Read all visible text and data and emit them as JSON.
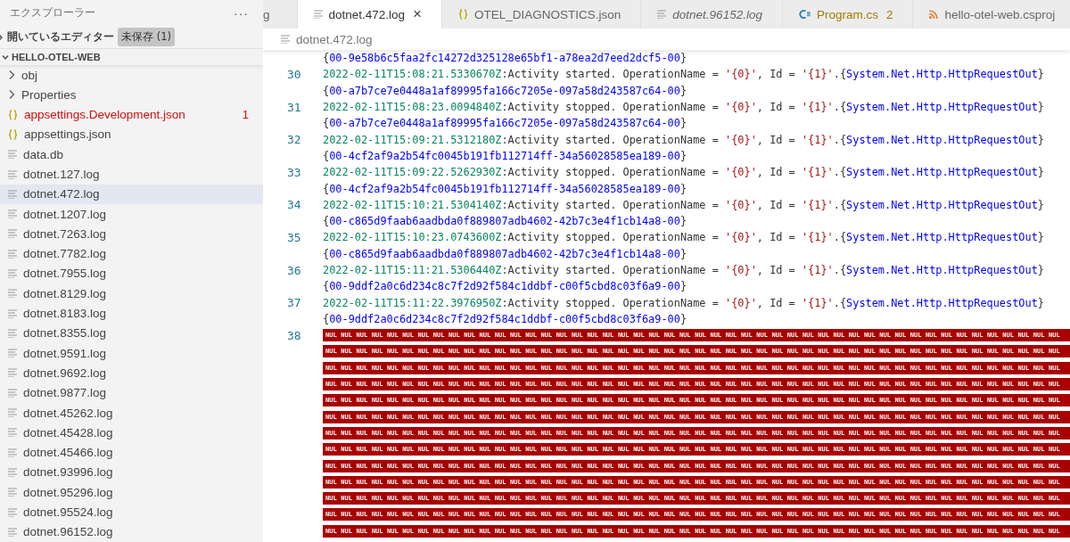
{
  "sidebar": {
    "title": "エクスプローラー",
    "more": "···",
    "open_editors": {
      "label": "開いているエディター",
      "badge": "未保存 (1)",
      "expanded": false
    },
    "project": {
      "label": "HELLO-OTEL-WEB",
      "expanded": true,
      "items": [
        {
          "label": "obj",
          "kind": "folder",
          "selected": false,
          "error": false
        },
        {
          "label": "Properties",
          "kind": "folder",
          "selected": false,
          "error": false
        },
        {
          "label": "appsettings.Development.json",
          "kind": "json",
          "selected": false,
          "error": true,
          "count": "1"
        },
        {
          "label": "appsettings.json",
          "kind": "json",
          "selected": false,
          "error": false
        },
        {
          "label": "data.db",
          "kind": "file",
          "selected": false,
          "error": false
        },
        {
          "label": "dotnet.127.log",
          "kind": "file",
          "selected": false,
          "error": false
        },
        {
          "label": "dotnet.472.log",
          "kind": "file",
          "selected": true,
          "error": false
        },
        {
          "label": "dotnet.1207.log",
          "kind": "file",
          "selected": false,
          "error": false
        },
        {
          "label": "dotnet.7263.log",
          "kind": "file",
          "selected": false,
          "error": false
        },
        {
          "label": "dotnet.7782.log",
          "kind": "file",
          "selected": false,
          "error": false
        },
        {
          "label": "dotnet.7955.log",
          "kind": "file",
          "selected": false,
          "error": false
        },
        {
          "label": "dotnet.8129.log",
          "kind": "file",
          "selected": false,
          "error": false
        },
        {
          "label": "dotnet.8183.log",
          "kind": "file",
          "selected": false,
          "error": false
        },
        {
          "label": "dotnet.8355.log",
          "kind": "file",
          "selected": false,
          "error": false
        },
        {
          "label": "dotnet.9591.log",
          "kind": "file",
          "selected": false,
          "error": false
        },
        {
          "label": "dotnet.9692.log",
          "kind": "file",
          "selected": false,
          "error": false
        },
        {
          "label": "dotnet.9877.log",
          "kind": "file",
          "selected": false,
          "error": false
        },
        {
          "label": "dotnet.45262.log",
          "kind": "file",
          "selected": false,
          "error": false
        },
        {
          "label": "dotnet.45428.log",
          "kind": "file",
          "selected": false,
          "error": false
        },
        {
          "label": "dotnet.45466.log",
          "kind": "file",
          "selected": false,
          "error": false
        },
        {
          "label": "dotnet.93996.log",
          "kind": "file",
          "selected": false,
          "error": false
        },
        {
          "label": "dotnet.95296.log",
          "kind": "file",
          "selected": false,
          "error": false
        },
        {
          "label": "dotnet.95524.log",
          "kind": "file",
          "selected": false,
          "error": false
        },
        {
          "label": "dotnet.96152.log",
          "kind": "file",
          "selected": false,
          "error": false
        }
      ]
    }
  },
  "tabs": [
    {
      "label": "g",
      "kind": "none",
      "selected": false,
      "italic": false,
      "warning": false
    },
    {
      "label": "dotnet.472.log",
      "kind": "file",
      "selected": true,
      "italic": false,
      "warning": false,
      "close": "×"
    },
    {
      "label": "OTEL_DIAGNOSTICS.json",
      "kind": "json",
      "selected": false,
      "italic": false,
      "warning": false
    },
    {
      "label": "dotnet.96152.log",
      "kind": "file",
      "selected": false,
      "italic": true,
      "warning": false
    },
    {
      "label": "Program.cs",
      "kind": "csharp",
      "selected": false,
      "italic": false,
      "warning": true,
      "count": "2"
    },
    {
      "label": "hello-otel-web.csproj",
      "kind": "rss",
      "selected": false,
      "italic": false,
      "warning": false
    }
  ],
  "breadcrumb": {
    "label": "dotnet.472.log"
  },
  "editor": {
    "rows": [
      {
        "segments": [
          {
            "kind": "plain",
            "text": "{"
          },
          {
            "kind": "type",
            "text": "00-9e58b6c5faa2fc14272d325128e65bf1-a78ea2d7eed2dcf5-00"
          },
          {
            "kind": "plain",
            "text": "}"
          }
        ]
      },
      {
        "number": "30",
        "segments": [
          {
            "kind": "timestamp",
            "text": "2022-02-11T15:08:21.5330670Z"
          },
          {
            "kind": "plain",
            "text": ":Activity started. OperationName = "
          },
          {
            "kind": "string",
            "text": "'{0}'"
          },
          {
            "kind": "plain",
            "text": ", Id = "
          },
          {
            "kind": "string",
            "text": "'{1}'"
          },
          {
            "kind": "plain",
            "text": ".{"
          },
          {
            "kind": "type",
            "text": "System.Net.Http.HttpRequestOut"
          },
          {
            "kind": "plain",
            "text": "}"
          }
        ]
      },
      {
        "segments": [
          {
            "kind": "plain",
            "text": "{"
          },
          {
            "kind": "type",
            "text": "00-a7b7ce7e0448a1af89995fa166c7205e-097a58d243587c64-00"
          },
          {
            "kind": "plain",
            "text": "}"
          }
        ]
      },
      {
        "number": "31",
        "segments": [
          {
            "kind": "timestamp",
            "text": "2022-02-11T15:08:23.0094840Z"
          },
          {
            "kind": "plain",
            "text": ":Activity stopped. OperationName = "
          },
          {
            "kind": "string",
            "text": "'{0}'"
          },
          {
            "kind": "plain",
            "text": ", Id = "
          },
          {
            "kind": "string",
            "text": "'{1}'"
          },
          {
            "kind": "plain",
            "text": ".{"
          },
          {
            "kind": "type",
            "text": "System.Net.Http.HttpRequestOut"
          },
          {
            "kind": "plain",
            "text": "}"
          }
        ]
      },
      {
        "segments": [
          {
            "kind": "plain",
            "text": "{"
          },
          {
            "kind": "type",
            "text": "00-a7b7ce7e0448a1af89995fa166c7205e-097a58d243587c64-00"
          },
          {
            "kind": "plain",
            "text": "}"
          }
        ]
      },
      {
        "number": "32",
        "segments": [
          {
            "kind": "timestamp",
            "text": "2022-02-11T15:09:21.5312180Z"
          },
          {
            "kind": "plain",
            "text": ":Activity started. OperationName = "
          },
          {
            "kind": "string",
            "text": "'{0}'"
          },
          {
            "kind": "plain",
            "text": ", Id = "
          },
          {
            "kind": "string",
            "text": "'{1}'"
          },
          {
            "kind": "plain",
            "text": ".{"
          },
          {
            "kind": "type",
            "text": "System.Net.Http.HttpRequestOut"
          },
          {
            "kind": "plain",
            "text": "}"
          }
        ]
      },
      {
        "segments": [
          {
            "kind": "plain",
            "text": "{"
          },
          {
            "kind": "type",
            "text": "00-4cf2af9a2b54fc0045b191fb112714ff-34a56028585ea189-00"
          },
          {
            "kind": "plain",
            "text": "}"
          }
        ]
      },
      {
        "number": "33",
        "segments": [
          {
            "kind": "timestamp",
            "text": "2022-02-11T15:09:22.5262930Z"
          },
          {
            "kind": "plain",
            "text": ":Activity stopped. OperationName = "
          },
          {
            "kind": "string",
            "text": "'{0}'"
          },
          {
            "kind": "plain",
            "text": ", Id = "
          },
          {
            "kind": "string",
            "text": "'{1}'"
          },
          {
            "kind": "plain",
            "text": ".{"
          },
          {
            "kind": "type",
            "text": "System.Net.Http.HttpRequestOut"
          },
          {
            "kind": "plain",
            "text": "}"
          }
        ]
      },
      {
        "segments": [
          {
            "kind": "plain",
            "text": "{"
          },
          {
            "kind": "type",
            "text": "00-4cf2af9a2b54fc0045b191fb112714ff-34a56028585ea189-00"
          },
          {
            "kind": "plain",
            "text": "}"
          }
        ]
      },
      {
        "number": "34",
        "segments": [
          {
            "kind": "timestamp",
            "text": "2022-02-11T15:10:21.5304140Z"
          },
          {
            "kind": "plain",
            "text": ":Activity started. OperationName = "
          },
          {
            "kind": "string",
            "text": "'{0}'"
          },
          {
            "kind": "plain",
            "text": ", Id = "
          },
          {
            "kind": "string",
            "text": "'{1}'"
          },
          {
            "kind": "plain",
            "text": ".{"
          },
          {
            "kind": "type",
            "text": "System.Net.Http.HttpRequestOut"
          },
          {
            "kind": "plain",
            "text": "}"
          }
        ]
      },
      {
        "segments": [
          {
            "kind": "plain",
            "text": "{"
          },
          {
            "kind": "type",
            "text": "00-c865d9faab6aadbda0f889807adb4602-42b7c3e4f1cb14a8-00"
          },
          {
            "kind": "plain",
            "text": "}"
          }
        ]
      },
      {
        "number": "35",
        "segments": [
          {
            "kind": "timestamp",
            "text": "2022-02-11T15:10:23.0743600Z"
          },
          {
            "kind": "plain",
            "text": ":Activity stopped. OperationName = "
          },
          {
            "kind": "string",
            "text": "'{0}'"
          },
          {
            "kind": "plain",
            "text": ", Id = "
          },
          {
            "kind": "string",
            "text": "'{1}'"
          },
          {
            "kind": "plain",
            "text": ".{"
          },
          {
            "kind": "type",
            "text": "System.Net.Http.HttpRequestOut"
          },
          {
            "kind": "plain",
            "text": "}"
          }
        ]
      },
      {
        "segments": [
          {
            "kind": "plain",
            "text": "{"
          },
          {
            "kind": "type",
            "text": "00-c865d9faab6aadbda0f889807adb4602-42b7c3e4f1cb14a8-00"
          },
          {
            "kind": "plain",
            "text": "}"
          }
        ]
      },
      {
        "number": "36",
        "segments": [
          {
            "kind": "timestamp",
            "text": "2022-02-11T15:11:21.5306440Z"
          },
          {
            "kind": "plain",
            "text": ":Activity started. OperationName = "
          },
          {
            "kind": "string",
            "text": "'{0}'"
          },
          {
            "kind": "plain",
            "text": ", Id = "
          },
          {
            "kind": "string",
            "text": "'{1}'"
          },
          {
            "kind": "plain",
            "text": ".{"
          },
          {
            "kind": "type",
            "text": "System.Net.Http.HttpRequestOut"
          },
          {
            "kind": "plain",
            "text": "}"
          }
        ]
      },
      {
        "segments": [
          {
            "kind": "plain",
            "text": "{"
          },
          {
            "kind": "type",
            "text": "00-9ddf2a0c6d234c8c7f2d92f584c1ddbf-c00f5cbd8c03f6a9-00"
          },
          {
            "kind": "plain",
            "text": "}"
          }
        ]
      },
      {
        "number": "37",
        "segments": [
          {
            "kind": "timestamp",
            "text": "2022-02-11T15:11:22.3976950Z"
          },
          {
            "kind": "plain",
            "text": ":Activity stopped. OperationName = "
          },
          {
            "kind": "string",
            "text": "'{0}'"
          },
          {
            "kind": "plain",
            "text": ", Id = "
          },
          {
            "kind": "string",
            "text": "'{1}'"
          },
          {
            "kind": "plain",
            "text": ".{"
          },
          {
            "kind": "type",
            "text": "System.Net.Http.HttpRequestOut"
          },
          {
            "kind": "plain",
            "text": "}"
          }
        ]
      },
      {
        "segments": [
          {
            "kind": "plain",
            "text": "{"
          },
          {
            "kind": "type",
            "text": "00-9ddf2a0c6d234c8c7f2d92f584c1ddbf-c00f5cbd8c03f6a9-00"
          },
          {
            "kind": "plain",
            "text": "}"
          }
        ]
      },
      {
        "number": "38",
        "segments": [
          {
            "kind": "nul",
            "text": "NUL NUL NUL NUL NUL NUL NUL NUL NUL NUL NUL NUL NUL NUL NUL NUL NUL NUL NUL NUL NUL NUL NUL NUL NUL NUL NUL NUL NUL NUL NUL NUL NUL NUL NUL NUL NUL NUL NUL NUL NUL NUL NUL NUL NUL NUL NUL NUL"
          }
        ]
      },
      {
        "segments": [
          {
            "kind": "nul",
            "text": "NUL NUL NUL NUL NUL NUL NUL NUL NUL NUL NUL NUL NUL NUL NUL NUL NUL NUL NUL NUL NUL NUL NUL NUL NUL NUL NUL NUL NUL NUL NUL NUL NUL NUL NUL NUL NUL NUL NUL NUL NUL NUL NUL NUL NUL NUL NUL NUL"
          }
        ]
      },
      {
        "segments": [
          {
            "kind": "nul",
            "text": "NUL NUL NUL NUL NUL NUL NUL NUL NUL NUL NUL NUL NUL NUL NUL NUL NUL NUL NUL NUL NUL NUL NUL NUL NUL NUL NUL NUL NUL NUL NUL NUL NUL NUL NUL NUL NUL NUL NUL NUL NUL NUL NUL NUL NUL NUL NUL NUL"
          }
        ]
      },
      {
        "segments": [
          {
            "kind": "nul",
            "text": "NUL NUL NUL NUL NUL NUL NUL NUL NUL NUL NUL NUL NUL NUL NUL NUL NUL NUL NUL NUL NUL NUL NUL NUL NUL NUL NUL NUL NUL NUL NUL NUL NUL NUL NUL NUL NUL NUL NUL NUL NUL NUL NUL NUL NUL NUL NUL NUL"
          }
        ]
      },
      {
        "segments": [
          {
            "kind": "nul",
            "text": "NUL NUL NUL NUL NUL NUL NUL NUL NUL NUL NUL NUL NUL NUL NUL NUL NUL NUL NUL NUL NUL NUL NUL NUL NUL NUL NUL NUL NUL NUL NUL NUL NUL NUL NUL NUL NUL NUL NUL NUL NUL NUL NUL NUL NUL NUL NUL NUL"
          }
        ]
      },
      {
        "segments": [
          {
            "kind": "nul",
            "text": "NUL NUL NUL NUL NUL NUL NUL NUL NUL NUL NUL NUL NUL NUL NUL NUL NUL NUL NUL NUL NUL NUL NUL NUL NUL NUL NUL NUL NUL NUL NUL NUL NUL NUL NUL NUL NUL NUL NUL NUL NUL NUL NUL NUL NUL NUL NUL NUL"
          }
        ]
      },
      {
        "segments": [
          {
            "kind": "nul",
            "text": "NUL NUL NUL NUL NUL NUL NUL NUL NUL NUL NUL NUL NUL NUL NUL NUL NUL NUL NUL NUL NUL NUL NUL NUL NUL NUL NUL NUL NUL NUL NUL NUL NUL NUL NUL NUL NUL NUL NUL NUL NUL NUL NUL NUL NUL NUL NUL NUL"
          }
        ]
      },
      {
        "segments": [
          {
            "kind": "nul",
            "text": "NUL NUL NUL NUL NUL NUL NUL NUL NUL NUL NUL NUL NUL NUL NUL NUL NUL NUL NUL NUL NUL NUL NUL NUL NUL NUL NUL NUL NUL NUL NUL NUL NUL NUL NUL NUL NUL NUL NUL NUL NUL NUL NUL NUL NUL NUL NUL NUL"
          }
        ]
      },
      {
        "segments": [
          {
            "kind": "nul",
            "text": "NUL NUL NUL NUL NUL NUL NUL NUL NUL NUL NUL NUL NUL NUL NUL NUL NUL NUL NUL NUL NUL NUL NUL NUL NUL NUL NUL NUL NUL NUL NUL NUL NUL NUL NUL NUL NUL NUL NUL NUL NUL NUL NUL NUL NUL NUL NUL NUL"
          }
        ]
      },
      {
        "segments": [
          {
            "kind": "nul",
            "text": "NUL NUL NUL NUL NUL NUL NUL NUL NUL NUL NUL NUL NUL NUL NUL NUL NUL NUL NUL NUL NUL NUL NUL NUL NUL NUL NUL NUL NUL NUL NUL NUL NUL NUL NUL NUL NUL NUL NUL NUL NUL NUL NUL NUL NUL NUL NUL NUL"
          }
        ]
      },
      {
        "segments": [
          {
            "kind": "nul",
            "text": "NUL NUL NUL NUL NUL NUL NUL NUL NUL NUL NUL NUL NUL NUL NUL NUL NUL NUL NUL NUL NUL NUL NUL NUL NUL NUL NUL NUL NUL NUL NUL NUL NUL NUL NUL NUL NUL NUL NUL NUL NUL NUL NUL NUL NUL NUL NUL NUL"
          }
        ]
      },
      {
        "segments": [
          {
            "kind": "nul",
            "text": "NUL NUL NUL NUL NUL NUL NUL NUL NUL NUL NUL NUL NUL NUL NUL NUL NUL NUL NUL NUL NUL NUL NUL NUL NUL NUL NUL NUL NUL NUL NUL NUL NUL NUL NUL NUL NUL NUL NUL NUL NUL NUL NUL NUL NUL NUL NUL NUL"
          }
        ]
      },
      {
        "segments": [
          {
            "kind": "nul",
            "text": "NUL NUL NUL NUL NUL NUL NUL NUL NUL NUL NUL NUL NUL NUL NUL NUL NUL NUL NUL NUL NUL NUL NUL NUL NUL NUL NUL NUL NUL NUL NUL NUL NUL NUL NUL NUL NUL NUL NUL NUL NUL NUL NUL NUL NUL NUL NUL NUL"
          }
        ]
      }
    ]
  }
}
